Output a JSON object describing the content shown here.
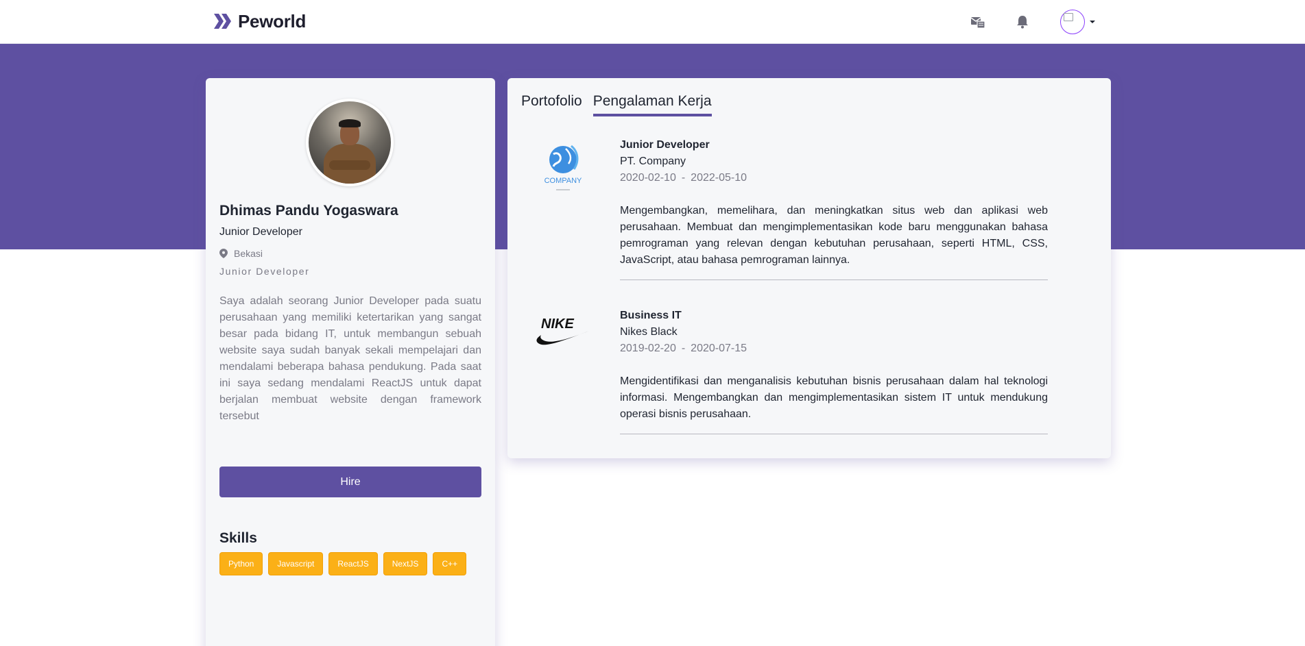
{
  "navbar": {
    "brand": "Peworld",
    "icons": [
      "mail-icon",
      "bell-icon"
    ],
    "avatar_alt": ""
  },
  "colors": {
    "primary": "#5e50a1",
    "skill_badge": "#fbb017",
    "background_card": "#f6f7f9"
  },
  "profile": {
    "name": "Dhimas Pandu Yogaswara",
    "role": "Junior Developer",
    "location": "Bekasi",
    "subrole": "Junior Developer",
    "bio": "Saya adalah seorang Junior Developer pada suatu perusahaan yang memiliki ketertarikan yang sangat besar pada bidang IT, untuk membangun sebuah website saya sudah banyak sekali mempelajari dan mendalami beberapa bahasa pendukung. Pada saat ini saya sedang mendalami ReactJS untuk dapat berjalan membuat website dengan framework tersebut",
    "hire_label": "Hire",
    "skills_title": "Skills",
    "skills": [
      "Python",
      "Javascript",
      "ReactJS",
      "NextJS",
      "C++"
    ]
  },
  "tabs": [
    {
      "label": "Portofolio",
      "active": false
    },
    {
      "label": "Pengalaman Kerja",
      "active": true
    }
  ],
  "experiences": [
    {
      "position": "Junior Developer",
      "company": "PT. Company",
      "start": "2020-02-10",
      "separator": "-",
      "end": "2022-05-10",
      "description": "Mengembangkan, memelihara, dan meningkatkan situs web dan aplikasi web perusahaan. Membuat dan mengimplementasikan kode baru menggunakan bahasa pemrograman yang relevan dengan kebutuhan perusahaan, seperti HTML, CSS, JavaScript, atau bahasa pemrograman lainnya.",
      "logo_text": "COMPANY"
    },
    {
      "position": "Business IT",
      "company": "Nikes Black",
      "start": "2019-02-20",
      "separator": "-",
      "end": "2020-07-15",
      "description": "Mengidentifikasi dan menganalisis kebutuhan bisnis perusahaan dalam hal teknologi informasi. Mengembangkan dan mengimplementasikan sistem IT untuk mendukung operasi bisnis perusahaan.",
      "logo_text": "NIKE"
    }
  ]
}
